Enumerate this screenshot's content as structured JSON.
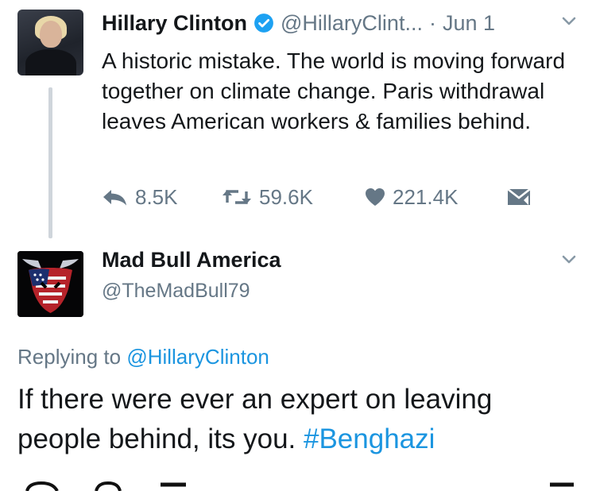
{
  "tweet": {
    "author_name": "Hillary Clinton",
    "handle": "@HillaryClint...",
    "separator": "·",
    "date": "Jun 1",
    "text": "A historic mistake. The world is moving forward together on climate change. Paris withdrawal leaves American workers & families behind.",
    "replies": "8.5K",
    "retweets": "59.6K",
    "likes": "221.4K"
  },
  "reply": {
    "author_name": "Mad Bull America",
    "handle": "@TheMadBull79",
    "replying_prefix": "Replying to",
    "replying_handle": "@HillaryClinton",
    "text": "If there were ever an expert on leaving people behind, its you.",
    "hashtag": "#Benghazi"
  },
  "colors": {
    "text": "#14171a",
    "secondary": "#657786",
    "link": "#1b95e0",
    "verified": "#1da1f2"
  },
  "icons": [
    "verified-badge-icon",
    "chevron-down-icon",
    "reply-icon",
    "retweet-icon",
    "heart-icon",
    "direct-message-icon"
  ]
}
